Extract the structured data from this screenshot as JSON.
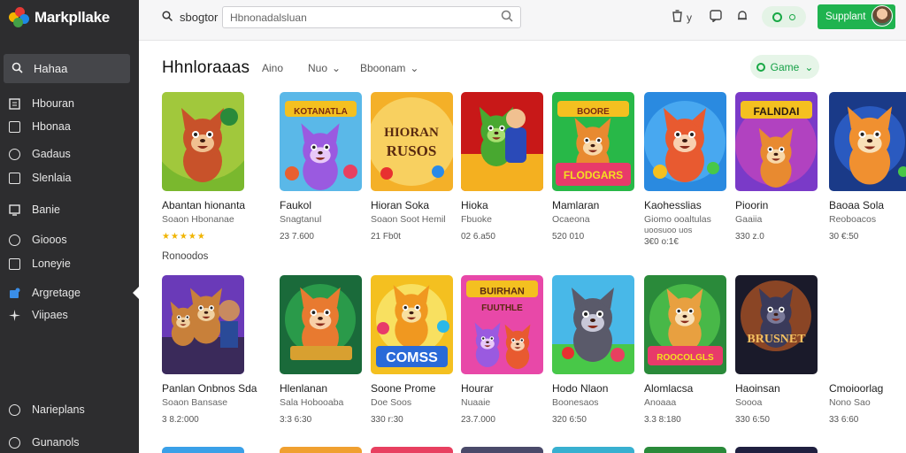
{
  "app": {
    "name": "Markpllake"
  },
  "sidebar": {
    "search_label": "Hahaa",
    "items": [
      {
        "label": "Hbouran",
        "icon": "list-icon"
      },
      {
        "label": "Hbonaa",
        "icon": "square-icon"
      },
      {
        "label": "Gadaus",
        "icon": "circle-icon"
      },
      {
        "label": "Slenlaia",
        "icon": "square-icon"
      },
      {
        "label": "Banie",
        "icon": "monitor-icon"
      },
      {
        "label": "Giooos",
        "icon": "circle-icon"
      },
      {
        "label": "Loneyie",
        "icon": "square-icon"
      },
      {
        "label": "Argretage",
        "icon": "puzzle-icon"
      },
      {
        "label": "Viipaes",
        "icon": "sparkle-icon"
      },
      {
        "label": "Narieplans",
        "icon": "chat-icon"
      },
      {
        "label": "Gunanols",
        "icon": "circle-icon"
      }
    ]
  },
  "topbar": {
    "label": "sbogtor",
    "search_value": "Hbnonadalsluan",
    "icon1_count": "y"
  },
  "main": {
    "title": "Hhnloraaas",
    "filters": [
      "Aino",
      "Nuo",
      "Bboonam"
    ],
    "game_button": "Game",
    "section2_label": "Ronoodos",
    "row1": [
      {
        "title": "Abantan hionanta",
        "sub": "Soaon Hbonanae",
        "meta": "★★★★★",
        "is_stars": true
      },
      {
        "title": "Faukol",
        "sub": "Snagtanul",
        "meta": "23 7.600"
      },
      {
        "title": "Hioran Soka",
        "sub": "Soaon Soot Hemil",
        "meta": "21 Fb0t"
      },
      {
        "title": "Hioka",
        "sub": "Fbuoke",
        "meta": "02 6.a50"
      },
      {
        "title": "Mamlaran",
        "sub": "Ocaeona",
        "meta": "520 010"
      },
      {
        "title": "Kaohesslias",
        "sub": "Giomo ooaltulas",
        "sub2": "uoosuoo uos",
        "meta": "3€0 o:1€"
      },
      {
        "title": "Pioorin",
        "sub": "Gaaiia",
        "meta": "330 z.0"
      },
      {
        "title": "Baoaa Sola",
        "sub": "Reoboacos",
        "meta": "30 €:50"
      }
    ],
    "row2": [
      {
        "title": "Panlan Onbnos Sda",
        "sub": "Soaon Bansase",
        "meta": "3 8.2:000"
      },
      {
        "title": "Hlenlanan",
        "sub": "Sala Hobooaba",
        "meta": "3:3 6:30"
      },
      {
        "title": "Soone Prome",
        "sub": "Doe Soos",
        "meta": "330 r:30"
      },
      {
        "title": "Hourar",
        "sub": "Nuaaie",
        "meta": "23.7.000"
      },
      {
        "title": "Hodo Nlaon",
        "sub": "Boonesaos",
        "meta": "320 6:50"
      },
      {
        "title": "Alomlacsa",
        "sub": "Anoaaa",
        "meta": "3.3 8:180"
      },
      {
        "title": "Haoinsan",
        "sub": "Soooa",
        "meta": "330 6:50"
      },
      {
        "title": "Cmoioorlag",
        "sub": "Nono Sao",
        "meta": "33 6:60"
      }
    ],
    "tile_texts": {
      "r1c2": "KOTANATLA",
      "r1c3": "HIORAN RUSOS",
      "r1c5a": "BOORE",
      "r1c5b": "FLODGARS",
      "r1c7": "FALNDAI",
      "r2c3": "COMSS",
      "r2c4": "BUIRHAN FUUTHLE",
      "r2c6": "ROOCOLGLS",
      "r2c7": "BRUSNET"
    }
  }
}
